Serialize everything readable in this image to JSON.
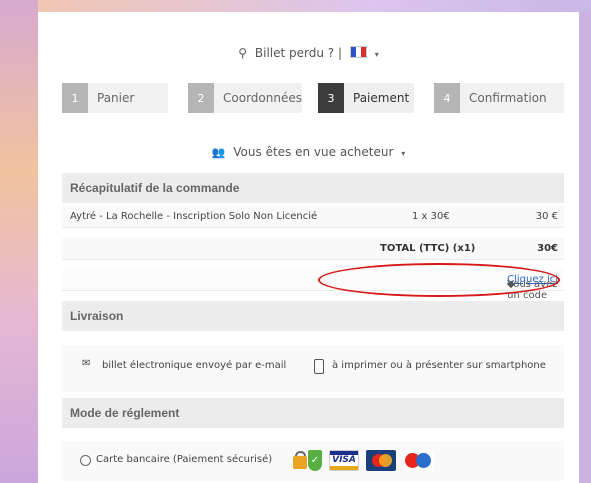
{
  "header": {
    "search_label": "Billet perdu ? |",
    "flag_icon": "french-flag",
    "language_caret": "▾"
  },
  "steps": [
    {
      "number": "1",
      "label": "Panier",
      "state": "inactive"
    },
    {
      "number": "2",
      "label": "Coordonnées",
      "state": "inactive"
    },
    {
      "number": "3",
      "label": "Paiement",
      "state": "active"
    },
    {
      "number": "4",
      "label": "Confirmation",
      "state": "inactive"
    }
  ],
  "buyer": {
    "label": "Vous êtes en vue acheteur",
    "caret": "▾"
  },
  "summary": {
    "title": "Récapitulatif de la commande",
    "item": {
      "name": "Aytré - La Rochelle - Inscription Solo Non Licencié",
      "qty_price": "1 x 30€",
      "amount": "30 €"
    },
    "total_label": "TOTAL (TTC) (x1)",
    "total_amount": "30€",
    "promo_text": "Vous avez un code de réduction ?",
    "promo_link": "Cliquez ici"
  },
  "delivery": {
    "title": "Livraison",
    "email_text": "billet électronique envoyé par e-mail",
    "print_text": "à imprimer ou à présenter sur smartphone"
  },
  "payment": {
    "title": "Mode de réglement",
    "option_label": "Carte bancaire (Paiement sécurisé)",
    "visa_text": "VISA",
    "logos": [
      "lock-icon",
      "shield-check-icon",
      "visa-logo",
      "mastercard-logo",
      "maestro-logo"
    ]
  },
  "colors": {
    "annotation_ellipse": "#d61a1a",
    "active_step": "#3c3c3c",
    "link": "#2c67c8"
  }
}
